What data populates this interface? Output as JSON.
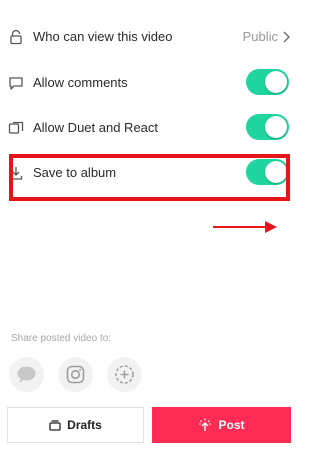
{
  "settings": {
    "rows": [
      {
        "label": "Who can view this video",
        "value": "Public",
        "icon": "lock-icon"
      },
      {
        "label": "Allow comments",
        "icon": "comment-icon",
        "toggle_on": true
      },
      {
        "label": "Allow Duet and React",
        "icon": "duet-icon",
        "toggle_on": true
      },
      {
        "label": "Save to album",
        "icon": "download-icon",
        "toggle_on": true
      }
    ]
  },
  "share": {
    "label": "Share posted video to:",
    "targets": [
      "messages-icon",
      "instagram-icon",
      "add-icon"
    ]
  },
  "actions": {
    "drafts_label": "Drafts",
    "post_label": "Post"
  },
  "colors": {
    "toggle_on": "#20d5a0",
    "post": "#fe2c55",
    "highlight": "#e8141c"
  }
}
